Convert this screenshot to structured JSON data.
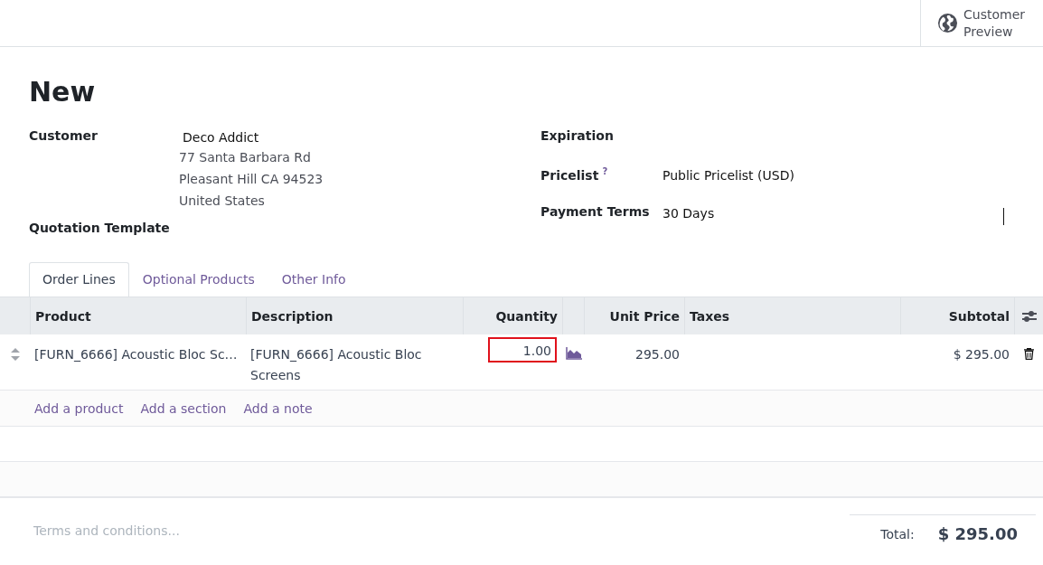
{
  "top_bar": {
    "preview_button": {
      "label_lines": [
        "Customer",
        "Preview"
      ]
    }
  },
  "title": "New",
  "left_fields": [
    {
      "label": "Customer",
      "value": "Deco Addict",
      "address": [
        "77 Santa Barbara Rd",
        "Pleasant Hill CA 94523",
        "United States"
      ]
    },
    {
      "label": "Quotation Template"
    }
  ],
  "right_fields": [
    {
      "label": "Expiration"
    },
    {
      "label": "Pricelist",
      "help_mark": "?",
      "value": "Public Pricelist (USD)"
    },
    {
      "label": "Payment Terms",
      "value": "30 Days"
    }
  ],
  "tabs": [
    {
      "label": "Order Lines",
      "selected": true
    },
    {
      "label": "Optional Products",
      "selected": false
    },
    {
      "label": "Other Info",
      "selected": false
    }
  ],
  "table": {
    "columns": [
      {
        "label": "Product"
      },
      {
        "label": "Description"
      },
      {
        "label": "Quantity"
      },
      {
        "label": "Unit Price"
      },
      {
        "label": "Taxes"
      },
      {
        "label": "Subtotal"
      }
    ],
    "rows": [
      {
        "product": "[FURN_6666] Acoustic Bloc Sc…",
        "description": "[FURN_6666] Acoustic Bloc Screens",
        "quantity": "1.00",
        "quantity_invalid": true,
        "unit_price": "295.00",
        "subtotal": "$ 295.00"
      }
    ],
    "add_links": [
      "Add a product",
      "Add a section",
      "Add a note"
    ]
  },
  "terms": {
    "placeholder": "Terms and conditions..."
  },
  "total": {
    "label": "Total:",
    "value": "$ 295.00"
  }
}
